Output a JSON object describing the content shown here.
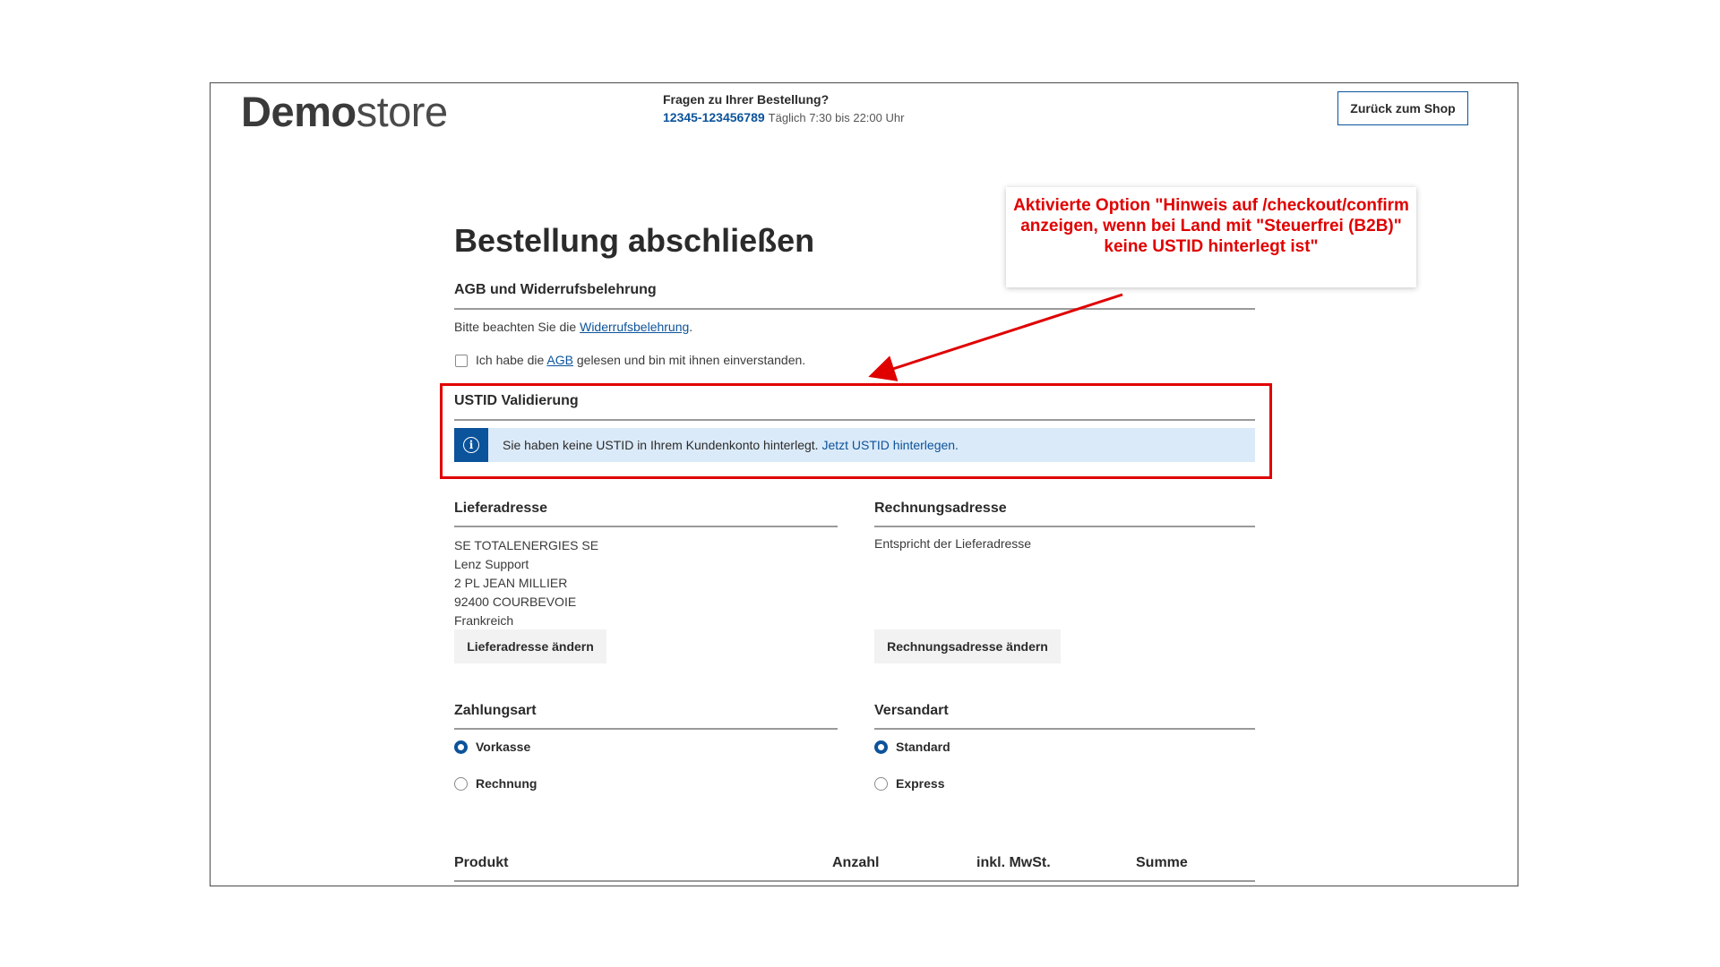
{
  "header": {
    "logo_bold": "Demo",
    "logo_light": "store",
    "contact_question": "Fragen zu Ihrer Bestellung?",
    "phone": "12345-123456789",
    "hours": "Täglich 7:30 bis 22:00 Uhr",
    "back_button": "Zurück zum Shop"
  },
  "title": "Bestellung abschließen",
  "terms": {
    "heading": "AGB und Widerrufsbelehrung",
    "notice_prefix": "Bitte beachten Sie die ",
    "notice_link": "Widerrufsbelehrung",
    "notice_suffix": ".",
    "checkbox_prefix": "Ich habe die ",
    "checkbox_link": "AGB",
    "checkbox_suffix": " gelesen und bin mit ihnen einverstanden."
  },
  "ustid": {
    "heading": "USTID Validierung",
    "icon": "info-icon",
    "message": "Sie haben keine USTID in Ihrem Kundenkonto hinterlegt. ",
    "link": "Jetzt USTID hinterlegen."
  },
  "shipping_address": {
    "heading": "Lieferadresse",
    "lines": [
      "SE TOTALENERGIES SE",
      "Lenz Support",
      "2 PL JEAN MILLIER",
      "92400 COURBEVOIE",
      "Frankreich"
    ],
    "button": "Lieferadresse ändern"
  },
  "billing_address": {
    "heading": "Rechnungsadresse",
    "text": "Entspricht der Lieferadresse",
    "button": "Rechnungsadresse ändern"
  },
  "payment": {
    "heading": "Zahlungsart",
    "options": [
      {
        "label": "Vorkasse",
        "selected": true
      },
      {
        "label": "Rechnung",
        "selected": false
      }
    ]
  },
  "shipping_method": {
    "heading": "Versandart",
    "options": [
      {
        "label": "Standard",
        "selected": true
      },
      {
        "label": "Express",
        "selected": false
      }
    ]
  },
  "table": {
    "columns": [
      "Produkt",
      "Anzahl",
      "inkl. MwSt.",
      "Summe"
    ]
  },
  "annotation": {
    "text": "Aktivierte Option \"Hinweis auf /checkout/confirm anzeigen, wenn bei Land mit \"Steuerfrei (B2B)\" keine USTID hinterlegt ist\"",
    "color": "#e00000"
  },
  "colors": {
    "accent": "#0b539b",
    "alert_bg": "#dbeaf8"
  }
}
